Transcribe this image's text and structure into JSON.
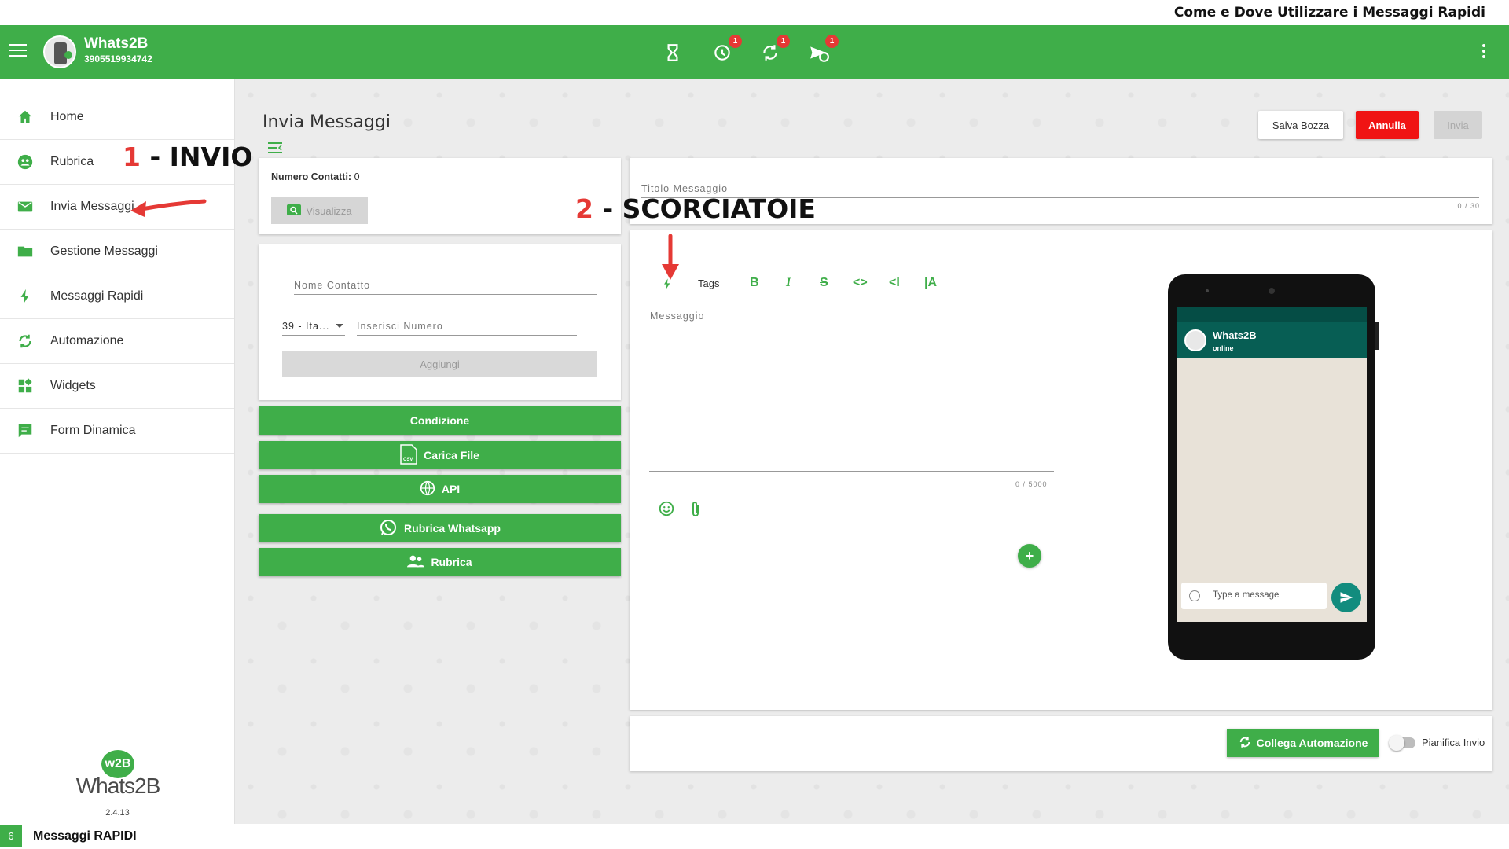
{
  "page_title": "Come e Dove Utilizzare i Messaggi Rapidi",
  "appbar": {
    "name": "Whats2B",
    "phone": "3905519934742",
    "badges": [
      "1",
      "1",
      "1"
    ]
  },
  "sidebar": {
    "items": [
      {
        "label": "Home",
        "icon": "home-icon"
      },
      {
        "label": "Rubrica",
        "icon": "contacts-icon"
      },
      {
        "label": "Invia Messaggi",
        "icon": "mail-icon"
      },
      {
        "label": "Gestione Messaggi",
        "icon": "folder-icon"
      },
      {
        "label": "Messaggi Rapidi",
        "icon": "bolt-icon"
      },
      {
        "label": "Automazione",
        "icon": "sync-icon"
      },
      {
        "label": "Widgets",
        "icon": "widgets-icon"
      },
      {
        "label": "Form Dinamica",
        "icon": "form-icon"
      }
    ],
    "version": "2.4.13",
    "logo_text": "Whats2B",
    "logo_badge": "w2B"
  },
  "main": {
    "title": "Invia Messaggi",
    "buttons": {
      "save_draft": "Salva Bozza",
      "cancel": "Annulla",
      "send": "Invia"
    },
    "contacts_label": "Numero Contatti:",
    "contacts_count": "0",
    "view_button": "Visualizza",
    "contact_name_placeholder": "Nome Contatto",
    "country_select": "39 - Ita...",
    "number_placeholder": "Inserisci Numero",
    "add_button": "Aggiungi",
    "actions": [
      "Condizione",
      "Carica File",
      "API",
      "Rubrica Whatsapp",
      "Rubrica"
    ],
    "message_title_placeholder": "Titolo Messaggio",
    "title_counter": "0 / 30",
    "tags_label": "Tags",
    "message_placeholder": "Messaggio",
    "message_counter": "0 / 5000",
    "collega_button": "Collega Automazione",
    "schedule_label": "Pianifica Invio"
  },
  "phone_preview": {
    "name": "Whats2B",
    "status": "online",
    "input_placeholder": "Type a message"
  },
  "annotations": {
    "one_num": "1",
    "one_text": " - INVIO",
    "two_num": "2",
    "two_text": " - SCORCIATOIE"
  },
  "footer": {
    "page_number": "6",
    "title": "Messaggi RAPIDI"
  },
  "colors": {
    "brand_green": "#3fae49",
    "annul_red": "#f01414",
    "annotation_red": "#e53935",
    "wa_teal": "#075e54"
  }
}
